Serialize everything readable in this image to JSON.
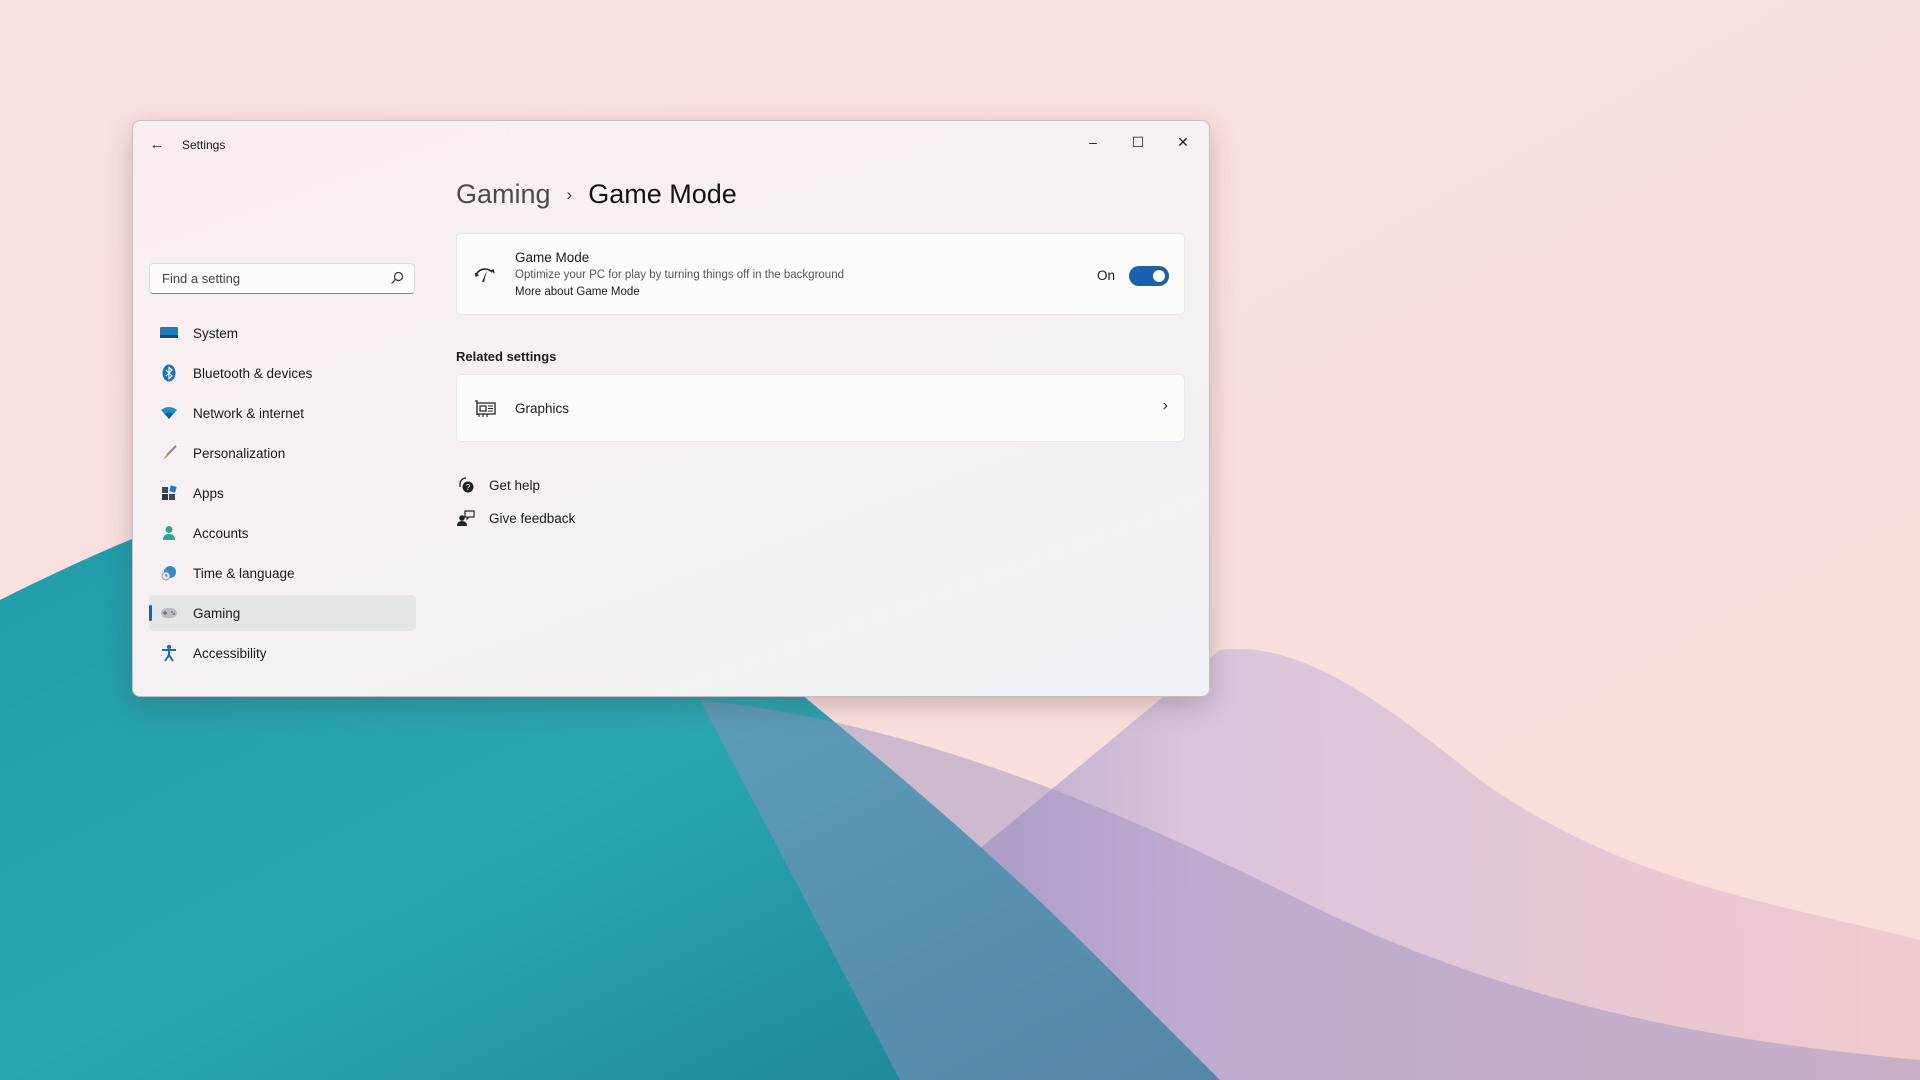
{
  "window": {
    "app_title": "Settings",
    "controls": {
      "minimize": "–",
      "maximize": "☐",
      "close": "✕"
    }
  },
  "search": {
    "placeholder": "Find a setting",
    "value": ""
  },
  "sidebar": {
    "items": [
      {
        "label": "System",
        "icon": "monitor-icon"
      },
      {
        "label": "Bluetooth & devices",
        "icon": "bluetooth-icon"
      },
      {
        "label": "Network & internet",
        "icon": "wifi-icon"
      },
      {
        "label": "Personalization",
        "icon": "brush-icon"
      },
      {
        "label": "Apps",
        "icon": "apps-icon"
      },
      {
        "label": "Accounts",
        "icon": "person-icon"
      },
      {
        "label": "Time & language",
        "icon": "globe-clock-icon"
      },
      {
        "label": "Gaming",
        "icon": "gamepad-icon",
        "active": true
      },
      {
        "label": "Accessibility",
        "icon": "accessibility-icon"
      }
    ]
  },
  "breadcrumb": {
    "parent": "Gaming",
    "separator": "›",
    "current": "Game Mode"
  },
  "game_mode": {
    "title": "Game Mode",
    "description": "Optimize your PC for play by turning things off in the background",
    "link": "More about Game Mode",
    "toggle_state": "On",
    "enabled": true
  },
  "related_settings": {
    "label": "Related settings",
    "items": [
      {
        "label": "Graphics",
        "icon": "graphics-card-icon"
      }
    ]
  },
  "help_links": [
    {
      "label": "Get help",
      "icon": "help-icon"
    },
    {
      "label": "Give feedback",
      "icon": "feedback-icon"
    }
  ],
  "colors": {
    "accent": "#1b5fb1",
    "wallpaper_teal": "#2aa7b4",
    "wallpaper_pink": "#f9dede"
  }
}
